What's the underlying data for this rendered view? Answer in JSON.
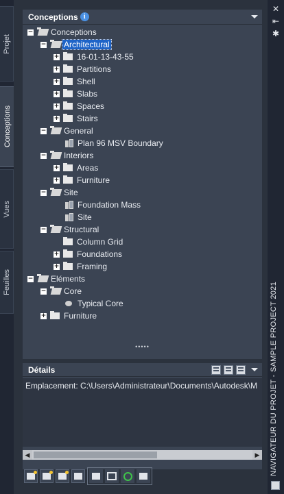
{
  "left_tabs": [
    {
      "label": "Projet"
    },
    {
      "label": "Conceptions"
    },
    {
      "label": "Vues"
    },
    {
      "label": "Feuilles"
    }
  ],
  "panel": {
    "title": "Conceptions",
    "info_glyph": "i"
  },
  "tree": {
    "root": "Conceptions",
    "architectural": "Architectural",
    "arch_children": [
      "16-01-13-43-55",
      "Partitions",
      "Shell",
      "Slabs",
      "Spaces",
      "Stairs"
    ],
    "general": "General",
    "general_children": [
      "Plan 96 MSV Boundary"
    ],
    "interiors": "Interiors",
    "interiors_children": [
      "Areas",
      "Furniture"
    ],
    "site": "Site",
    "site_children": [
      "Foundation Mass",
      "Site"
    ],
    "structural": "Structural",
    "structural_children": [
      "Column Grid",
      "Foundations",
      "Framing"
    ],
    "elements": "Eléments",
    "core": "Core",
    "core_children": [
      "Typical Core"
    ],
    "elements_furniture": "Furniture"
  },
  "splitter_glyph": "•••••",
  "details": {
    "title": "Détails",
    "location": "Emplacement: C:\\Users\\Administrateur\\Documents\\Autodesk\\M"
  },
  "scroll_arrows": {
    "left": "◀",
    "right": "▶"
  },
  "right_strip": {
    "close_glyph": "✕",
    "pin_glyph": "⇤",
    "settings_glyph": "✱",
    "title": "NAVIGATEUR DU PROJET - SAMPLE PROJECT 2021"
  },
  "colors": {
    "selection": "#1e64c8",
    "panel_bg": "#3b4453",
    "info_icon": "#4a90e2",
    "refresh_icon": "#3fc24a"
  }
}
